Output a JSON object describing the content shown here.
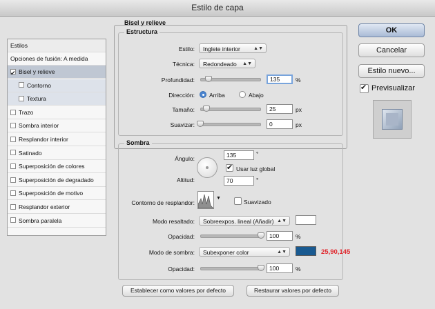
{
  "window": {
    "title": "Estilo de capa"
  },
  "sidebar": {
    "header": "Estilos",
    "blending": "Opciones de fusión: A medida",
    "items": [
      {
        "label": "Bisel y relieve",
        "checked": true,
        "selected": true,
        "sub": false
      },
      {
        "label": "Contorno",
        "checked": false,
        "selected": false,
        "sub": true
      },
      {
        "label": "Textura",
        "checked": false,
        "selected": false,
        "sub": true
      },
      {
        "label": "Trazo",
        "checked": false,
        "selected": false,
        "sub": false
      },
      {
        "label": "Sombra interior",
        "checked": false,
        "selected": false,
        "sub": false
      },
      {
        "label": "Resplandor interior",
        "checked": false,
        "selected": false,
        "sub": false
      },
      {
        "label": "Satinado",
        "checked": false,
        "selected": false,
        "sub": false
      },
      {
        "label": "Superposición de colores",
        "checked": false,
        "selected": false,
        "sub": false
      },
      {
        "label": "Superposición de degradado",
        "checked": false,
        "selected": false,
        "sub": false
      },
      {
        "label": "Superposición de motivo",
        "checked": false,
        "selected": false,
        "sub": false
      },
      {
        "label": "Resplandor exterior",
        "checked": false,
        "selected": false,
        "sub": false
      },
      {
        "label": "Sombra paralela",
        "checked": false,
        "selected": false,
        "sub": false
      }
    ]
  },
  "bevel": {
    "section_title": "Bisel y relieve",
    "structure_title": "Estructura",
    "style_label": "Estilo:",
    "style_value": "Inglete interior",
    "technique_label": "Técnica:",
    "technique_value": "Redondeado",
    "depth_label": "Profundidad:",
    "depth_value": "135",
    "depth_unit": "%",
    "depth_fraction": 0.135,
    "direction_label": "Dirección:",
    "direction_up": "Arriba",
    "direction_down": "Abajo",
    "size_label": "Tamaño:",
    "size_value": "25",
    "size_unit": "px",
    "size_fraction": 0.1,
    "soften_label": "Suavizar:",
    "soften_value": "0",
    "soften_unit": "px",
    "soften_fraction": 0.0
  },
  "shading": {
    "title": "Sombra",
    "angle_label": "Ángulo:",
    "angle_value": "135",
    "angle_unit": "°",
    "global_light_label": "Usar luz global",
    "global_light_checked": true,
    "altitude_label": "Altitud:",
    "altitude_value": "70",
    "altitude_unit": "°",
    "gloss_label": "Contorno de resplandor:",
    "antialias_label": "Suavizado",
    "highlight_label": "Modo resaltado:",
    "highlight_value": "Sobreexpos. lineal (Añadir)",
    "highlight_color": "#ffffff",
    "hl_opacity_label": "Opacidad:",
    "hl_opacity_value": "100",
    "hl_opacity_unit": "%",
    "hl_opacity_fraction": 1.0,
    "shadow_label": "Modo de sombra:",
    "shadow_value": "Subexponer color",
    "shadow_color": "#195a91",
    "shadow_rgb": "25,90,145",
    "shadow_rgb_color": "#e0282e",
    "sh_opacity_label": "Opacidad:",
    "sh_opacity_value": "100",
    "sh_opacity_unit": "%",
    "sh_opacity_fraction": 1.0
  },
  "buttons": {
    "default_label": "Establecer como valores por defecto",
    "reset_label": "Restaurar valores por defecto",
    "ok": "OK",
    "cancel": "Cancelar",
    "new_style": "Estilo nuevo...",
    "preview_label": "Previsualizar",
    "preview_checked": true
  }
}
